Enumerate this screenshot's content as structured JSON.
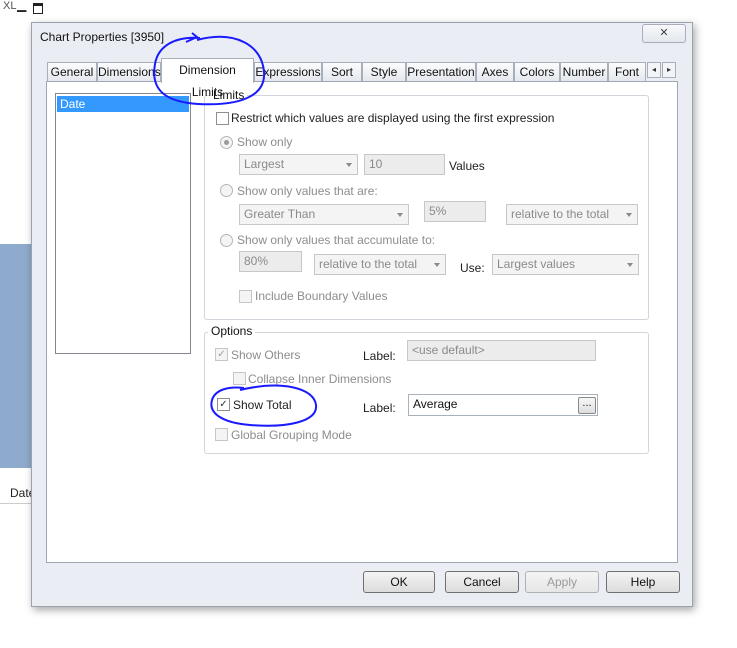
{
  "background": {
    "app_label": "XL",
    "left_label": "Date"
  },
  "dialog": {
    "title": "Chart Properties [3950]",
    "close_glyph": "✕"
  },
  "tabs": [
    {
      "label": "General"
    },
    {
      "label": "Dimensions"
    },
    {
      "label": "Dimension Limits"
    },
    {
      "label": "Expressions"
    },
    {
      "label": "Sort"
    },
    {
      "label": "Style"
    },
    {
      "label": "Presentation"
    },
    {
      "label": "Axes"
    },
    {
      "label": "Colors"
    },
    {
      "label": "Number"
    },
    {
      "label": "Font"
    }
  ],
  "tab_scroll": {
    "left": "◂",
    "right": "▸"
  },
  "dimensions_list": [
    "Date"
  ],
  "limits": {
    "group_label": "Limits",
    "restrict_label": "Restrict which values are displayed using the first expression",
    "show_only_label": "Show only",
    "show_only_combo": "Largest",
    "show_only_value": "10",
    "values_label": "Values",
    "show_only_values_label": "Show only values that are:",
    "comparison_combo": "Greater Than",
    "comparison_value": "5%",
    "relative_combo_1": "relative to the total",
    "accumulate_label": "Show only values that accumulate to:",
    "accumulate_value": "80%",
    "relative_combo_2": "relative to the total",
    "use_label": "Use:",
    "use_combo": "Largest values",
    "boundary_label": "Include Boundary Values"
  },
  "options": {
    "group_label": "Options",
    "show_others_label": "Show Others",
    "label_text_1": "Label:",
    "others_label_placeholder": "<use default>",
    "collapse_label": "Collapse Inner Dimensions",
    "show_total_label": "Show Total",
    "label_text_2": "Label:",
    "total_label_value": "Average",
    "dots_glyph": "...",
    "global_grouping_label": "Global Grouping Mode"
  },
  "buttons": {
    "ok": "OK",
    "cancel": "Cancel",
    "apply": "Apply",
    "help": "Help"
  },
  "annotation_color": "#1a1aff"
}
